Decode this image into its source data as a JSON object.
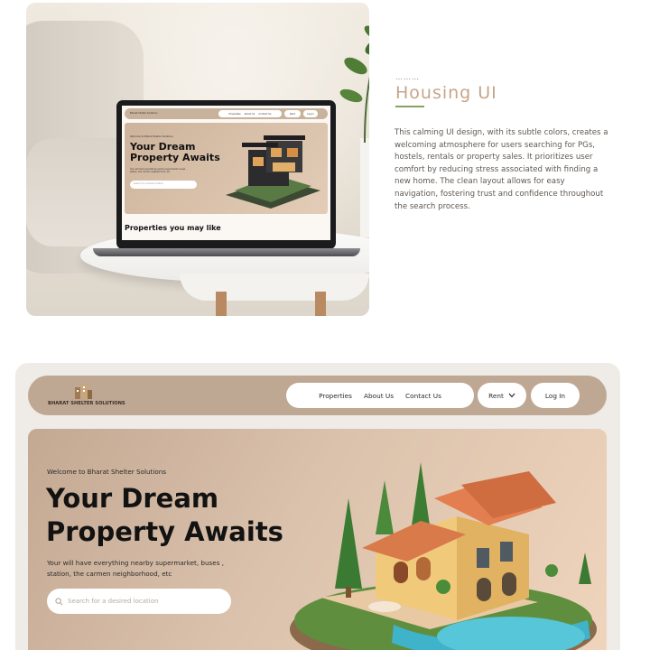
{
  "showcase": {
    "dots": "………",
    "heading": "Housing UI",
    "description": "This calming UI design, with its subtle colors, creates a welcoming atmosphere for users searching for PGs, hostels, rentals or property sales. It prioritizes user comfort by reducing stress associated with finding a new home. The clean layout allows for easy navigation, fostering trust and confidence throughout the search process."
  },
  "laptop_screen": {
    "logo_text": "Bharat Shelter Solutions",
    "nav_links": [
      "Properties",
      "About Us",
      "Contact Us"
    ],
    "rent_label": "Rent",
    "login_label": "Log In",
    "welcome": "Welcome to Bharat Shelter Solutions",
    "title": "Your Dream Property Awaits",
    "subtitle": "Your will have everything nearby supermarket, buses , station, the carmen neighborhood, etc",
    "search_placeholder": "Search for a desired location",
    "section_heading": "Properties you may like"
  },
  "site": {
    "logo_text": "BHARAT SHELTER SOLUTIONS",
    "nav": {
      "links": [
        "Properties",
        "About Us",
        "Contact Us"
      ],
      "rent_label": "Rent",
      "login_label": "Log In"
    },
    "hero": {
      "welcome": "Welcome to Bharat Shelter Solutions",
      "title_line1": "Your Dream",
      "title_line2": "Property Awaits",
      "subtitle": "Your will have everything nearby supermarket, buses , station, the carmen neighborhood, etc",
      "search_placeholder": "Search for a desired location"
    }
  },
  "colors": {
    "nav_bg": "#bfa893",
    "hero_gradient_start": "#c3a892",
    "hero_gradient_end": "#f0d5bd",
    "heading_accent": "#c7a48a",
    "underline_accent": "#8ba05e"
  },
  "icons": [
    "chevron-down-icon",
    "search-icon",
    "logo-building-icon"
  ]
}
